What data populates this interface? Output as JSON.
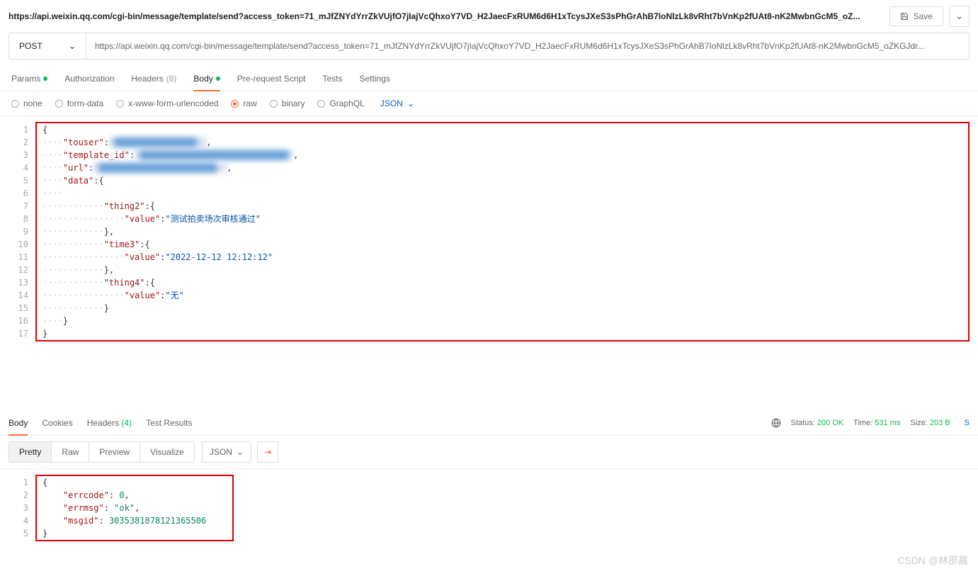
{
  "header": {
    "url_display": "https://api.weixin.qq.com/cgi-bin/message/template/send?access_token=71_mJfZNYdYrrZkVUjfO7jIajVcQhxoY7VD_H2JaecFxRUM6d6H1xTcysJXeS3sPhGrAhB7IoNlzLk8vRht7bVnKp2fUAt8-nK2MwbnGcM5_oZ...",
    "save_label": "Save"
  },
  "request": {
    "method": "POST",
    "url": "https://api.weixin.qq.com/cgi-bin/message/template/send?access_token=71_mJfZNYdYrrZkVUjfO7jIajVcQhxoY7VD_H2JaecFxRUM6d6H1xTcysJXeS3sPhGrAhB7IoNlzLk8vRht7bVnKp2fUAt8-nK2MwbnGcM5_oZKGJdr..."
  },
  "tabs": {
    "params": "Params",
    "auth": "Authorization",
    "headers": "Headers",
    "headers_count": "(8)",
    "body": "Body",
    "prereq": "Pre-request Script",
    "tests": "Tests",
    "settings": "Settings"
  },
  "body_types": {
    "none": "none",
    "formdata": "form-data",
    "xform": "x-www-form-urlencoded",
    "raw": "raw",
    "binary": "binary",
    "graphql": "GraphQL",
    "json": "JSON"
  },
  "body_code": {
    "l1": "{",
    "l2_k": "\"touser\"",
    "l2_v": "\"████████████████k\"",
    "l3_k": "\"template_id\"",
    "l3_v": "\"█████████████████████████████\"",
    "l4_k": "\"url\"",
    "l4_v": "\"███████████████████████/\"",
    "l5_k": "\"data\"",
    "l7_k": "\"thing2\"",
    "l8_k": "\"value\"",
    "l8_v": "\"测试拍卖场次审核通过\"",
    "l10_k": "\"time3\"",
    "l11_k": "\"value\"",
    "l11_v": "\"2022-12-12 12:12:12\"",
    "l13_k": "\"thing4\"",
    "l14_k": "\"value\"",
    "l14_v": "\"无\"",
    "l17": "}"
  },
  "response_tabs": {
    "body": "Body",
    "cookies": "Cookies",
    "headers": "Headers",
    "headers_count": "(4)",
    "testres": "Test Results"
  },
  "status": {
    "status_label": "Status:",
    "status_val": "200 OK",
    "time_label": "Time:",
    "time_val": "531 ms",
    "size_label": "Size:",
    "size_val": "203 B",
    "save_resp": "S"
  },
  "view": {
    "pretty": "Pretty",
    "raw": "Raw",
    "preview": "Preview",
    "visualize": "Visualize",
    "json": "JSON"
  },
  "resp_code": {
    "l1": "{",
    "l2_k": "\"errcode\"",
    "l2_v": "0",
    "l3_k": "\"errmsg\"",
    "l3_v": "\"ok\"",
    "l4_k": "\"msgid\"",
    "l4_v": "3035381878121365506",
    "l5": "}"
  },
  "watermark": "CSDN @林邵晨"
}
